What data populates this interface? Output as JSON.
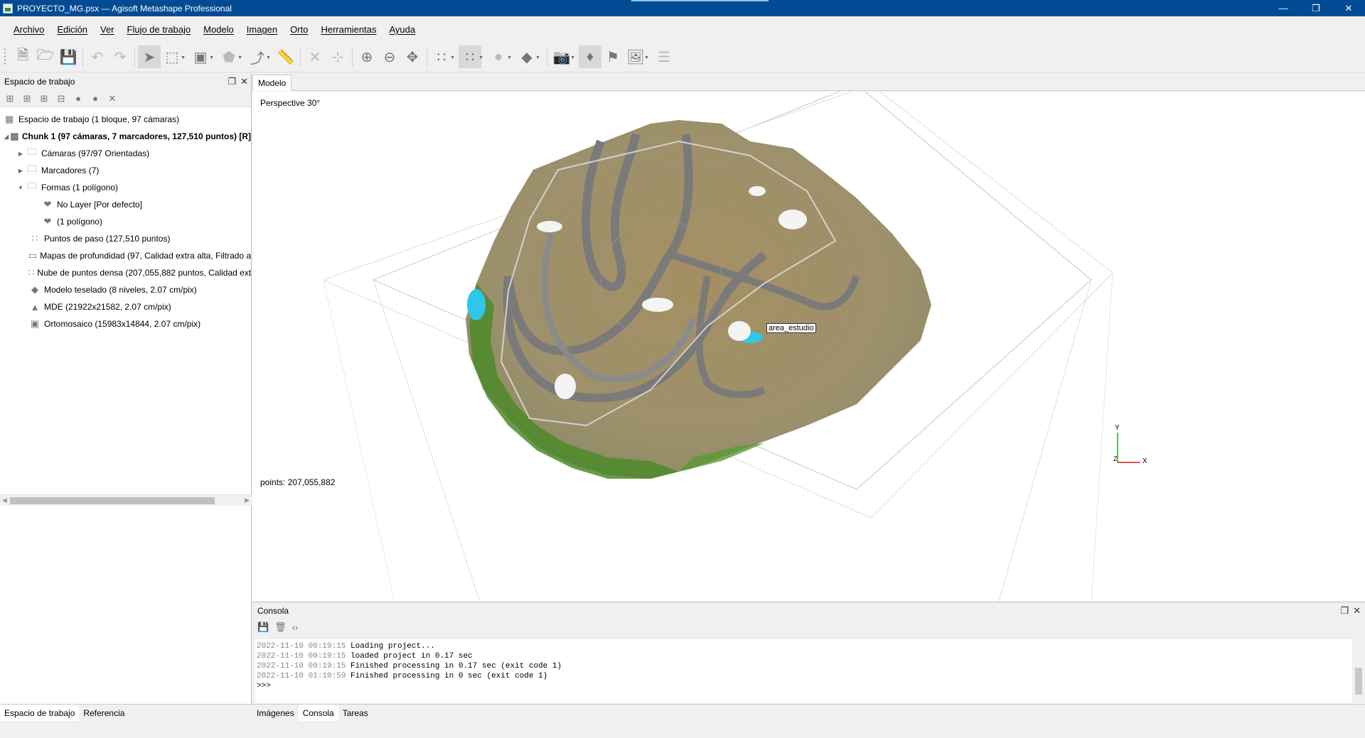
{
  "window": {
    "title": "PROYECTO_MG.psx — Agisoft Metashape Professional"
  },
  "menu": [
    "Archivo",
    "Edición",
    "Ver",
    "Flujo de trabajo",
    "Modelo",
    "Imagen",
    "Orto",
    "Herramientas",
    "Ayuda"
  ],
  "workspace": {
    "title": "Espacio de trabajo",
    "root": "Espacio de trabajo (1 bloque, 97 cámaras)",
    "chunk": "Chunk 1 (97 cámaras, 7 marcadores, 127,510 puntos) [R]",
    "items": [
      "Cámaras (97/97 Orientadas)",
      "Marcadores (7)",
      "Formas (1 polígono)",
      "No Layer [Por defecto]",
      "(1 polígono)",
      "Puntos de paso (127,510 puntos)",
      "Mapas de profundidad (97, Calidad extra alta, Filtrado a",
      "Nube de puntos densa (207,055,882 puntos, Calidad ext",
      "Modelo teselado (8 niveles, 2.07 cm/pix)",
      "MDE (21922x21582, 2.07 cm/pix)",
      "Ortomosaico (15983x14844, 2.07 cm/pix)"
    ]
  },
  "left_tabs": [
    "Espacio de trabajo",
    "Referencia"
  ],
  "view": {
    "tab": "Modelo",
    "projection": "Perspective 30°",
    "points": "points: 207,055,882",
    "shape_label": "area_estudio",
    "axis_y": "Y",
    "axis_x": "X",
    "axis_z": "Z"
  },
  "console": {
    "title": "Consola",
    "lines": [
      {
        "ts": "2022-11-10 00:19:15",
        "msg": "Loading project..."
      },
      {
        "ts": "2022-11-10 00:19:15",
        "msg": "loaded project in 0.17 sec"
      },
      {
        "ts": "2022-11-10 00:19:15",
        "msg": "Finished processing in 0.17 sec (exit code 1)"
      },
      {
        "ts": "2022-11-10 01:10:59",
        "msg": "Finished processing in 0 sec (exit code 1)"
      }
    ],
    "prompt": ">>>"
  },
  "bottom_tabs": [
    "Imágenes",
    "Consola",
    "Tareas"
  ],
  "colors": {
    "titlebar": "#004b93",
    "terrain": "#a0916a",
    "road": "#777777",
    "vegetation": "#4a8a2a",
    "water": "#2ec4e6"
  }
}
